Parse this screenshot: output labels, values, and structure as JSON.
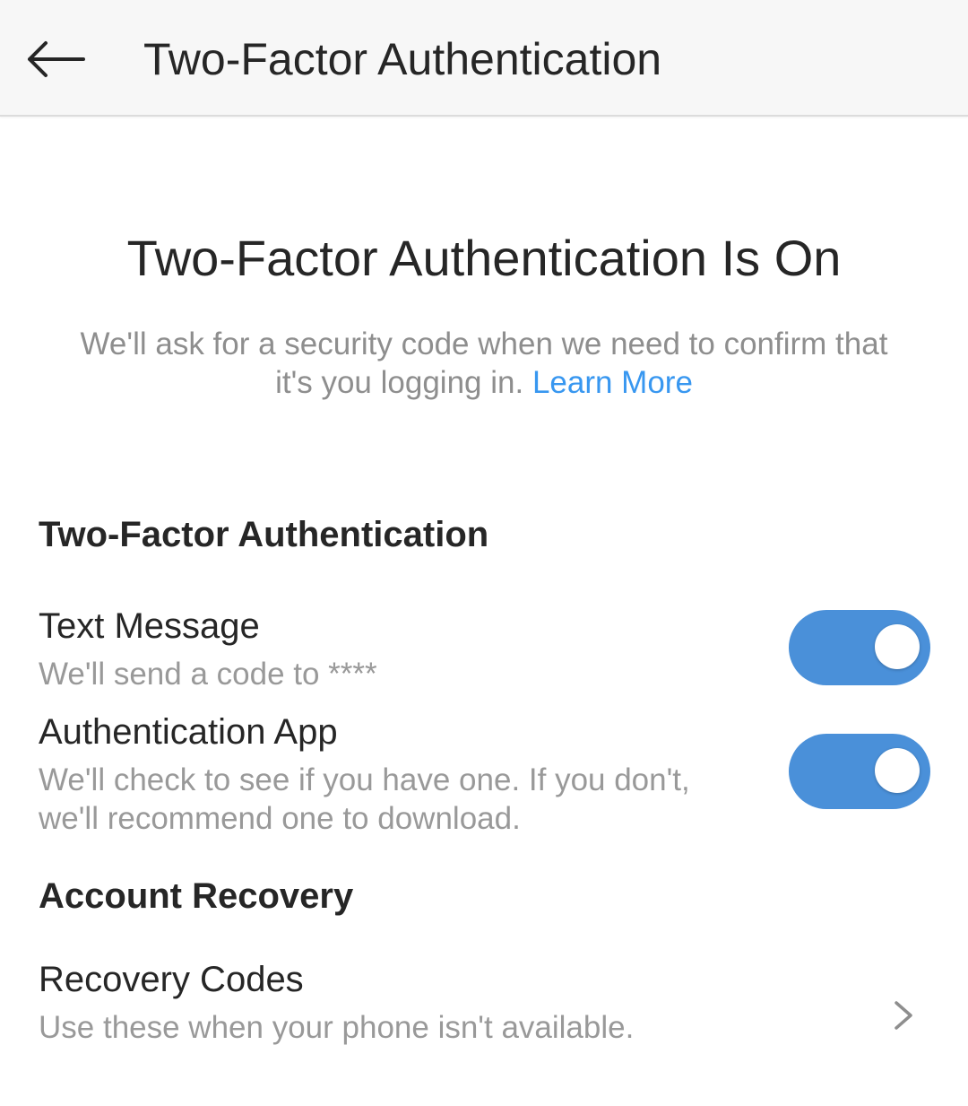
{
  "header": {
    "title": "Two-Factor Authentication",
    "back_icon": "arrow-left-icon"
  },
  "hero": {
    "title": "Two-Factor Authentication Is On",
    "description_line1": "We'll ask for a security code when we need to confirm that",
    "description_line2": "it's you logging in.",
    "learn_more": "Learn More"
  },
  "two_factor": {
    "heading": "Two-Factor Authentication",
    "text_message": {
      "title": "Text Message",
      "subtitle": "We'll send a code to ****",
      "enabled": true
    },
    "auth_app": {
      "title": "Authentication App",
      "subtitle_line1": "We'll check to see if you have one. If you don't,",
      "subtitle_line2": "we'll recommend one to download.",
      "enabled": true
    }
  },
  "account_recovery": {
    "heading": "Account Recovery",
    "recovery_codes": {
      "title": "Recovery Codes",
      "subtitle": "Use these when your phone isn't available.",
      "chevron_icon": "chevron-right-icon"
    }
  },
  "colors": {
    "accent": "#3897f0",
    "toggle_on": "#4a90d9",
    "text_primary": "#262626",
    "text_secondary": "#999999",
    "header_bg": "#f7f7f7"
  }
}
